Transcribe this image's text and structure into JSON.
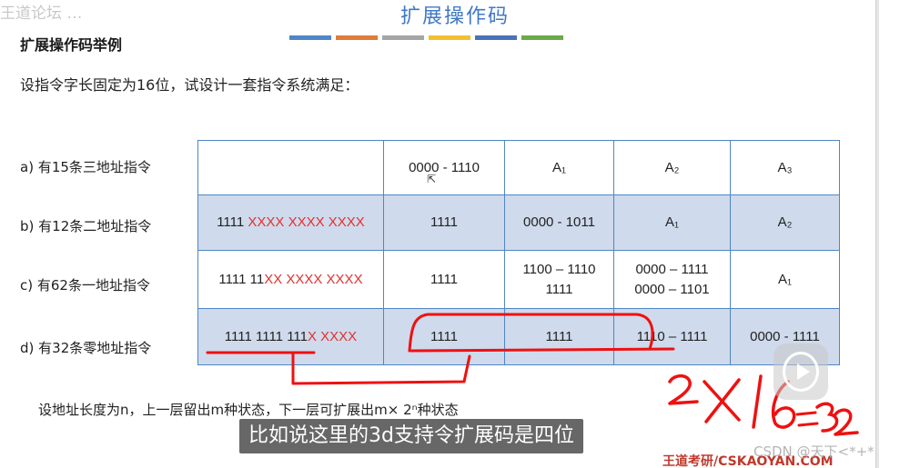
{
  "watermark_top": "王道论坛 …",
  "slide": {
    "title": "扩展操作码",
    "subtitle": "扩展操作码举例",
    "intro": "设指令字长固定为16位，试设计一套指令系统满足：",
    "accent_colors": [
      "#4f86c6",
      "#e07b39",
      "#a5a5a5",
      "#f2c02f",
      "#4a72b8",
      "#6aaa48"
    ]
  },
  "rows": [
    {
      "label_prefix": "a) 有",
      "label_num": "15",
      "label_suffix": "条三地址指令",
      "format_black": "",
      "format_red": "",
      "cells": [
        "0000 - 1110",
        "A₁",
        "A₂",
        "A₃"
      ]
    },
    {
      "label_prefix": "b) 有",
      "label_num": "12",
      "label_suffix": "条二地址指令",
      "format_black": "1111 ",
      "format_red": "XXXX XXXX XXXX",
      "cells": [
        "1111",
        "0000 - 1011",
        "A₁",
        "A₂"
      ]
    },
    {
      "label_prefix": "c) 有",
      "label_num": "62",
      "label_suffix": "条一地址指令",
      "format_black": "1111 11",
      "format_red": "XX XXXX XXXX",
      "cells": [
        "1111",
        "1100 – 1110",
        "0000 – 1111",
        "A₁"
      ],
      "cells_line2": [
        "",
        "1111",
        "0000 – 1101",
        ""
      ]
    },
    {
      "label_prefix": "d) 有",
      "label_num": "32",
      "label_suffix": "条零地址指令",
      "format_black": "1111 1111 111",
      "format_red": "X XXXX",
      "cells": [
        "1111",
        "1111",
        "1110 – 1111",
        "0000 - 1111"
      ]
    }
  ],
  "formula": "设地址长度为n，上一层留出m种状态，下一层可扩展出m× 2ⁿ种状态",
  "caption": "比如说这里的3d支持令扩展码是四位",
  "footer_brand": "王道考研/CSKAOYAN.COM",
  "csdn_mark": "CSDN @天下<*+*>",
  "handwriting": "2×16=32"
}
